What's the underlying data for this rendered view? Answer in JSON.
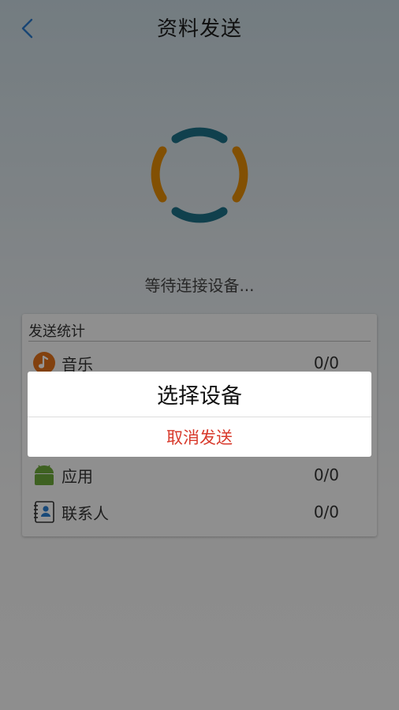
{
  "header": {
    "title": "资料发送",
    "back_icon": "chevron-left-icon"
  },
  "spinner": {
    "icon": "loading-spinner-icon",
    "colors": {
      "teal": "#1d6e86",
      "orange": "#e08a06"
    }
  },
  "status": {
    "waiting_text": "等待连接设备..."
  },
  "stats": {
    "header": "发送统计",
    "items": [
      {
        "icon": "music-note-icon",
        "label": "音乐",
        "count": "0/0"
      },
      {
        "icon": "android-app-icon",
        "label": "应用",
        "count": "0/0"
      },
      {
        "icon": "contacts-book-icon",
        "label": "联系人",
        "count": "0/0"
      }
    ]
  },
  "dialog": {
    "title": "选择设备",
    "cancel_label": "取消发送",
    "cancel_color": "#d83a2c"
  }
}
